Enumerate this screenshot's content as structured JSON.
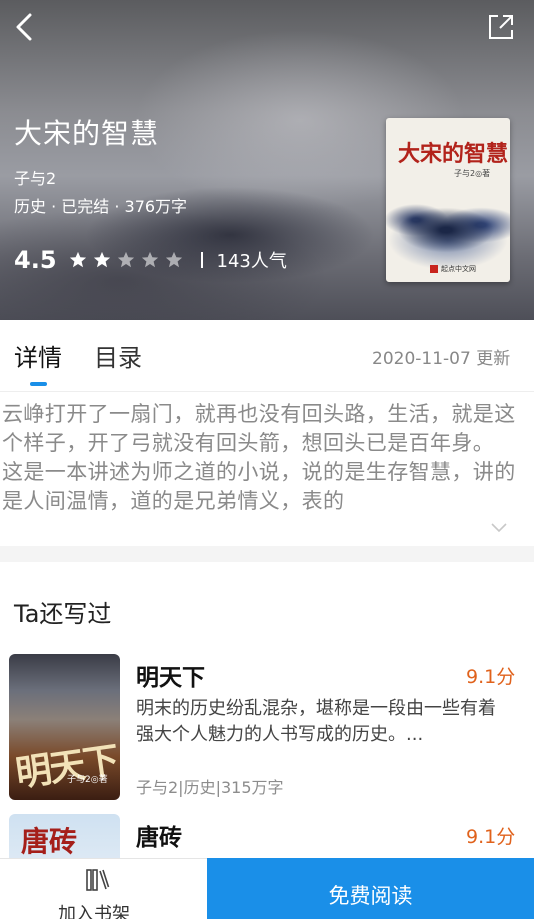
{
  "header": {
    "title": "大宋的智慧",
    "author": "子与2",
    "meta": "历史 · 已完结 · 376万字",
    "rating": "4.5",
    "stars": 2,
    "stars_total": 5,
    "popularity": "143人气",
    "back_icon": "chevron-left-icon",
    "share_icon": "share-icon",
    "cover": {
      "title": "大宋的智慧",
      "subtitle": "子与2◎著",
      "publisher": "起点中文网"
    }
  },
  "tabs": {
    "details": "详情",
    "toc": "目录",
    "update": "2020-11-07 更新"
  },
  "description": "云峥打开了一扇门，就再也没有回头路，生活，就是这个样子，开了弓就没有回头箭，想回头已是百年身。  这是一本讲述为师之道的小说，说的是生存智慧，讲的是人间温情，道的是兄弟情义，表的",
  "also_written": {
    "title": "Ta还写过",
    "books": [
      {
        "name": "明天下",
        "score": "9.1分",
        "intro": "明末的历史纷乱混杂，堪称是一段由一些有着强大个人魅力的人书写成的历史。...",
        "meta": "子与2|历史|315万字",
        "cover_text": "明天下",
        "cover_author": "子与2◎著"
      },
      {
        "name": "唐砖",
        "score": "9.1分",
        "cover_text": "唐砖"
      }
    ]
  },
  "bottom_bar": {
    "shelf_label": "加入书架",
    "read_label": "免费阅读"
  },
  "colors": {
    "accent": "#1a8fe8",
    "score": "#e0621c"
  }
}
